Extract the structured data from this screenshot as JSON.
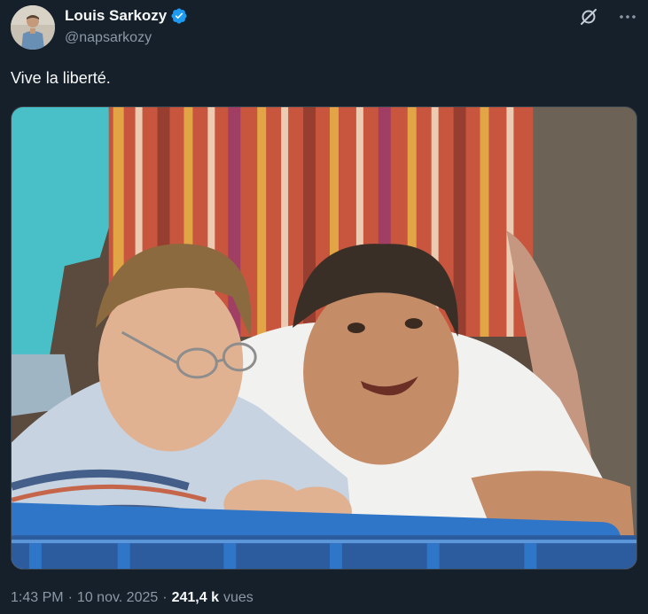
{
  "author": {
    "display_name": "Louis Sarkozy",
    "handle": "@napsarkozy",
    "verified": true,
    "verified_color": "#1d9bf0"
  },
  "icons": {
    "grok": "grok-icon",
    "more": "more-icon",
    "verified": "verified-badge-icon"
  },
  "tweet": {
    "text": "Vive la liberté."
  },
  "meta": {
    "time": "1:43 PM",
    "separator": "·",
    "date": "10 nov. 2025",
    "views_count": "241,4 k",
    "views_label": "vues"
  },
  "colors": {
    "background": "#15202b",
    "text_primary": "#f7f9f9",
    "text_secondary": "#8b98a5",
    "border": "#38444d"
  }
}
